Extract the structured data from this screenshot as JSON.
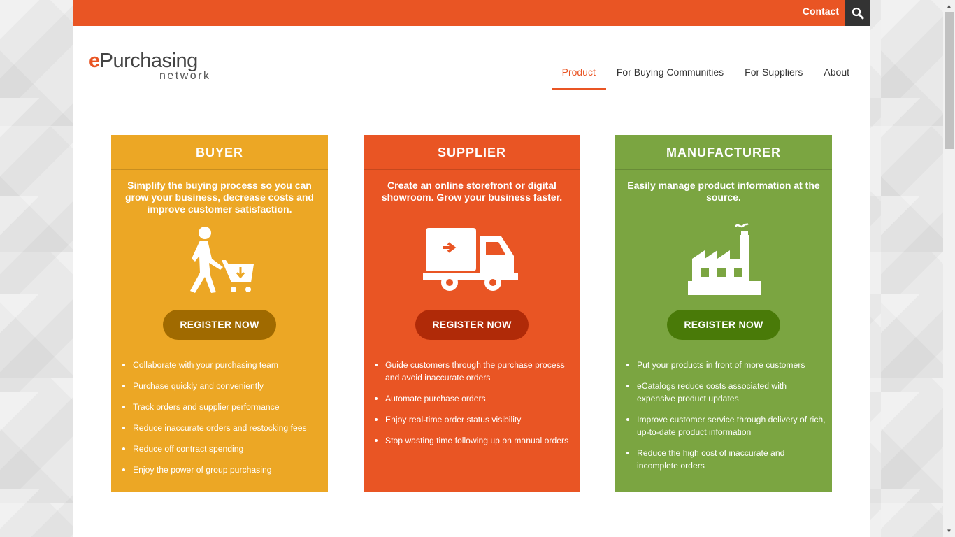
{
  "topbar": {
    "contact_label": "Contact",
    "search_icon": "search-icon",
    "accent_color": "#e95524"
  },
  "logo": {
    "e": "e",
    "main": "Purchasing",
    "sub": "network"
  },
  "nav": {
    "items": [
      {
        "label": "Product",
        "active": true
      },
      {
        "label": "For Buying Communities",
        "active": false
      },
      {
        "label": "For Suppliers",
        "active": false
      },
      {
        "label": "About",
        "active": false
      }
    ]
  },
  "cards": [
    {
      "title": "BUYER",
      "tagline": "Simplify the buying process so you can grow your business, decrease costs and improve customer satisfaction.",
      "icon": "shopping-cart-person-icon",
      "button": "REGISTER NOW",
      "color": "#eca725",
      "features": [
        "Collaborate with your purchasing team",
        "Purchase quickly and conveniently",
        "Track orders and supplier performance",
        "Reduce inaccurate orders and restocking fees",
        "Reduce off contract spending",
        "Enjoy the power of group purchasing"
      ]
    },
    {
      "title": "SUPPLIER",
      "tagline": "Create an online storefront or digital showroom. Grow your business faster.",
      "icon": "delivery-truck-icon",
      "button": "REGISTER NOW",
      "color": "#e95524",
      "features": [
        "Guide customers through the purchase process and avoid inaccurate orders",
        "Automate purchase orders",
        "Enjoy real-time order status visibility",
        "Stop wasting time following up on manual orders"
      ]
    },
    {
      "title": "MANUFACTURER",
      "tagline": "Easily manage product information at the source.",
      "icon": "factory-icon",
      "button": "REGISTER NOW",
      "color": "#7ba541",
      "features": [
        "Put your products in front of more customers",
        "eCatalogs reduce costs associated with expensive product updates",
        "Improve customer service through delivery of rich, up-to-date product information",
        "Reduce the high cost of inaccurate and incomplete orders"
      ]
    }
  ]
}
